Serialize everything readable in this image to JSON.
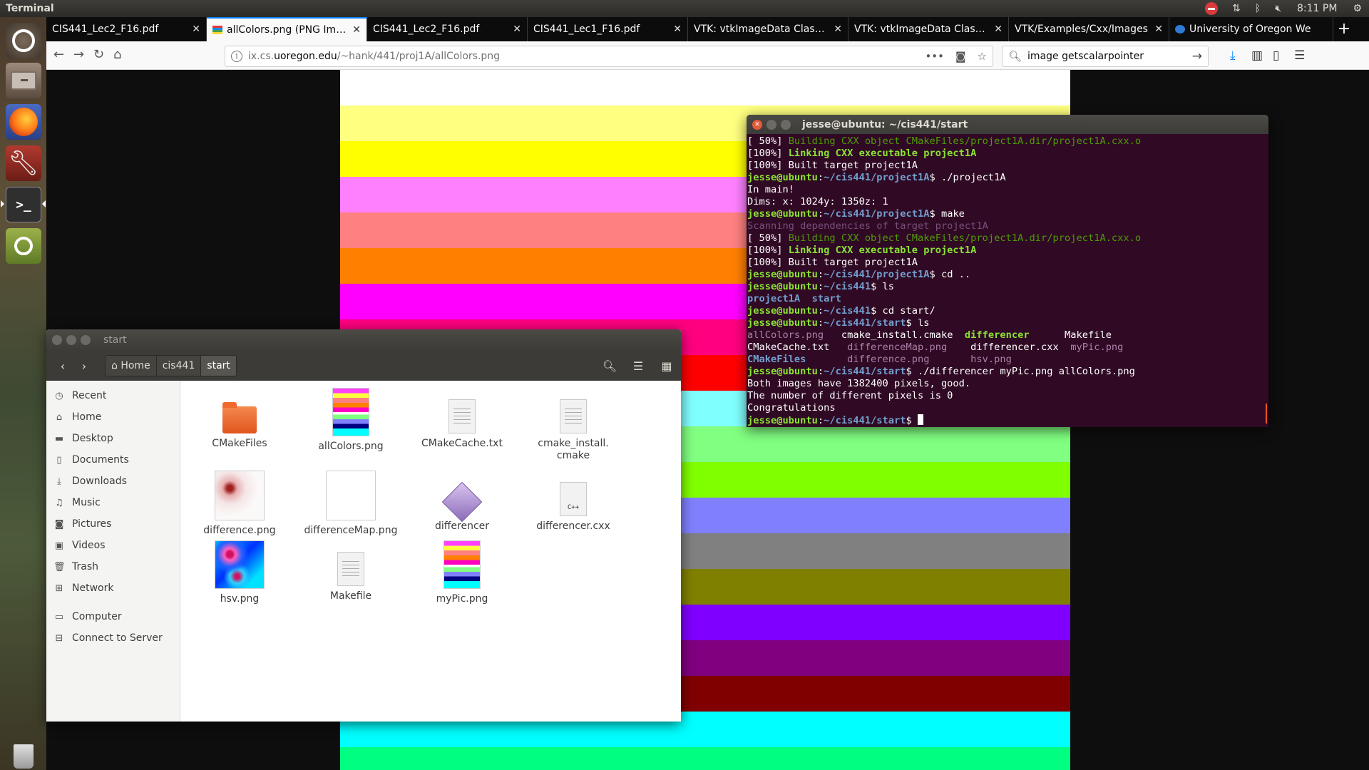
{
  "top_panel": {
    "app_title": "Terminal",
    "clock": "8:11 PM"
  },
  "browser": {
    "tabs": [
      {
        "label": "CIS441_Lec2_F16.pdf",
        "active": false,
        "favicon": "none"
      },
      {
        "label": "allColors.png (PNG Image",
        "active": true,
        "favicon": "png-icon"
      },
      {
        "label": "CIS441_Lec2_F16.pdf",
        "active": false,
        "favicon": "none"
      },
      {
        "label": "CIS441_Lec1_F16.pdf",
        "active": false,
        "favicon": "none"
      },
      {
        "label": "VTK: vtkImageData Class Re",
        "active": false,
        "favicon": "none"
      },
      {
        "label": "VTK: vtkImageData Class Re",
        "active": false,
        "favicon": "none"
      },
      {
        "label": "VTK/Examples/Cxx/Images",
        "active": false,
        "favicon": "none"
      },
      {
        "label": "University of Oregon We",
        "active": false,
        "favicon": "uo-icon"
      }
    ],
    "url_prefix": "ix.cs.",
    "url_host": "uoregon.edu",
    "url_path": "/~hank/441/proj1A/allColors.png",
    "search_value": "image getscalarpointer",
    "image_stripes": [
      "#ffffff",
      "#ffff80",
      "#ffff00",
      "#ff80ff",
      "#ff8080",
      "#ff8000",
      "#ff00ff",
      "#ff0080",
      "#ff0000",
      "#80ffff",
      "#80ff80",
      "#80ff00",
      "#8080ff",
      "#808080",
      "#808000",
      "#8000ff",
      "#800080",
      "#800000",
      "#00ffff",
      "#00ff80"
    ]
  },
  "file_manager": {
    "title": "start",
    "breadcrumbs": [
      "Home",
      "cis441",
      "start"
    ],
    "sidebar": [
      {
        "label": "Recent",
        "icon": "clock-icon"
      },
      {
        "label": "Home",
        "icon": "home-icon"
      },
      {
        "label": "Desktop",
        "icon": "desktop-icon"
      },
      {
        "label": "Documents",
        "icon": "document-icon"
      },
      {
        "label": "Downloads",
        "icon": "download-icon"
      },
      {
        "label": "Music",
        "icon": "music-icon"
      },
      {
        "label": "Pictures",
        "icon": "camera-icon"
      },
      {
        "label": "Videos",
        "icon": "video-icon"
      },
      {
        "label": "Trash",
        "icon": "trash-icon"
      },
      {
        "label": "Network",
        "icon": "network-icon"
      },
      {
        "label": "Computer",
        "icon": "computer-icon"
      },
      {
        "label": "Connect to Server",
        "icon": "server-icon"
      }
    ],
    "files": [
      {
        "name": "CMakeFiles",
        "type": "folder"
      },
      {
        "name": "allColors.png",
        "type": "image-stripes"
      },
      {
        "name": "CMakeCache.txt",
        "type": "text"
      },
      {
        "name": "cmake_install.\ncmake",
        "type": "text"
      },
      {
        "name": "difference.png",
        "type": "image-diff"
      },
      {
        "name": "differenceMap.png",
        "type": "image-blank"
      },
      {
        "name": "differencer",
        "type": "executable"
      },
      {
        "name": "differencer.cxx",
        "type": "cpp"
      },
      {
        "name": "hsv.png",
        "type": "image-hsv"
      },
      {
        "name": "Makefile",
        "type": "text"
      },
      {
        "name": "myPic.png",
        "type": "image-stripes"
      }
    ]
  },
  "terminal": {
    "title": "jesse@ubuntu: ~/cis441/start",
    "lines": [
      [
        {
          "t": "[ 50%] "
        },
        {
          "t": "Building CXX object CMakeFiles/project1A.dir/project1A.cxx.o",
          "c": "c-dim"
        }
      ],
      [
        {
          "t": "[100%] "
        },
        {
          "t": "Linking CXX executable project1A",
          "c": "c-green"
        }
      ],
      [
        {
          "t": "[100%] Built target project1A"
        }
      ],
      [
        {
          "t": "jesse@ubuntu",
          "c": "c-green"
        },
        {
          "t": ":"
        },
        {
          "t": "~/cis441/project1A",
          "c": "c-blue"
        },
        {
          "t": "$ ./project1A"
        }
      ],
      [
        {
          "t": "In main!"
        }
      ],
      [
        {
          "t": "Dims: x: 1024y: 1350z: 1"
        }
      ],
      [
        {
          "t": "jesse@ubuntu",
          "c": "c-green"
        },
        {
          "t": ":"
        },
        {
          "t": "~/cis441/project1A",
          "c": "c-blue"
        },
        {
          "t": "$ make"
        }
      ],
      [
        {
          "t": "Scanning dependencies of target project1A",
          "c": "c-purple"
        }
      ],
      [
        {
          "t": "[ 50%] "
        },
        {
          "t": "Building CXX object CMakeFiles/project1A.dir/project1A.cxx.o",
          "c": "c-dim"
        }
      ],
      [
        {
          "t": "[100%] "
        },
        {
          "t": "Linking CXX executable project1A",
          "c": "c-green"
        }
      ],
      [
        {
          "t": "[100%] Built target project1A"
        }
      ],
      [
        {
          "t": "jesse@ubuntu",
          "c": "c-green"
        },
        {
          "t": ":"
        },
        {
          "t": "~/cis441/project1A",
          "c": "c-blue"
        },
        {
          "t": "$ cd .."
        }
      ],
      [
        {
          "t": "jesse@ubuntu",
          "c": "c-green"
        },
        {
          "t": ":"
        },
        {
          "t": "~/cis441",
          "c": "c-blue"
        },
        {
          "t": "$ ls"
        }
      ],
      [
        {
          "t": "project1A",
          "c": "c-blue"
        },
        {
          "t": "  "
        },
        {
          "t": "start",
          "c": "c-blue"
        }
      ],
      [
        {
          "t": "jesse@ubuntu",
          "c": "c-green"
        },
        {
          "t": ":"
        },
        {
          "t": "~/cis441",
          "c": "c-blue"
        },
        {
          "t": "$ cd start/"
        }
      ],
      [
        {
          "t": "jesse@ubuntu",
          "c": "c-green"
        },
        {
          "t": ":"
        },
        {
          "t": "~/cis441/start",
          "c": "c-blue"
        },
        {
          "t": "$ ls"
        }
      ],
      [
        {
          "t": "allColors.png",
          "c": "c-mag"
        },
        {
          "t": "   cmake_install.cmake  "
        },
        {
          "t": "differencer",
          "c": "c-green"
        },
        {
          "t": "      Makefile"
        }
      ],
      [
        {
          "t": "CMakeCache.txt   "
        },
        {
          "t": "differenceMap.png",
          "c": "c-mag"
        },
        {
          "t": "    differencer.cxx  "
        },
        {
          "t": "myPic.png",
          "c": "c-mag"
        }
      ],
      [
        {
          "t": "CMakeFiles",
          "c": "c-blue"
        },
        {
          "t": "       "
        },
        {
          "t": "difference.png",
          "c": "c-mag"
        },
        {
          "t": "       "
        },
        {
          "t": "hsv.png",
          "c": "c-mag"
        }
      ],
      [
        {
          "t": "jesse@ubuntu",
          "c": "c-green"
        },
        {
          "t": ":"
        },
        {
          "t": "~/cis441/start",
          "c": "c-blue"
        },
        {
          "t": "$ ./differencer myPic.png allColors.png"
        }
      ],
      [
        {
          "t": "Both images have 1382400 pixels, good."
        }
      ],
      [
        {
          "t": "The number of different pixels is 0"
        }
      ],
      [
        {
          "t": "Congratulations"
        }
      ],
      [
        {
          "t": "jesse@ubuntu",
          "c": "c-green"
        },
        {
          "t": ":"
        },
        {
          "t": "~/cis441/start",
          "c": "c-blue"
        },
        {
          "t": "$ "
        },
        {
          "cursor": true
        }
      ]
    ]
  }
}
